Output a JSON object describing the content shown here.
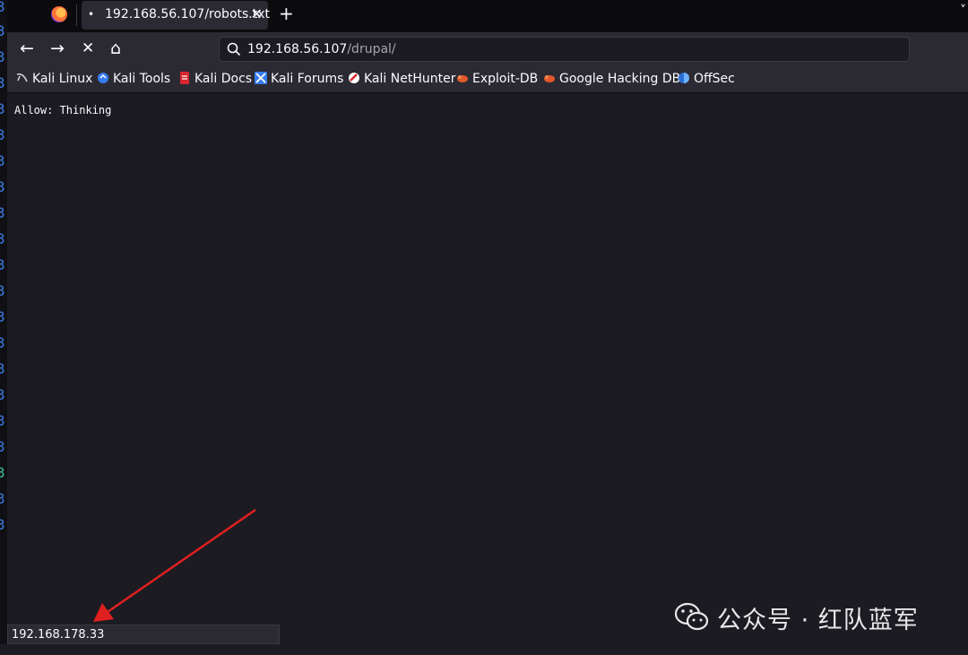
{
  "browser": {
    "tab": {
      "title": "192.168.56.107/robots.txt",
      "dot": "•",
      "close": "✕"
    },
    "new_tab": "+",
    "tab_menu": "˅",
    "nav": {
      "back": "←",
      "forward": "→",
      "stop": "✕",
      "home": "⌂"
    },
    "url": {
      "host": "192.168.56.107",
      "path": "/drupal/"
    }
  },
  "bookmarks": [
    {
      "label": "Kali Linux",
      "icon": "kali-dragon-icon"
    },
    {
      "label": "Kali Tools",
      "icon": "kali-tools-icon"
    },
    {
      "label": "Kali Docs",
      "icon": "kali-docs-icon"
    },
    {
      "label": "Kali Forums",
      "icon": "kali-forums-icon"
    },
    {
      "label": "Kali NetHunter",
      "icon": "nethunter-icon"
    },
    {
      "label": "Exploit-DB",
      "icon": "exploit-db-icon"
    },
    {
      "label": "Google Hacking DB",
      "icon": "ghdb-icon"
    },
    {
      "label": "OffSec",
      "icon": "offsec-icon"
    }
  ],
  "content": {
    "text": "Allow: Thinking"
  },
  "status": {
    "text": "192.168.178.33"
  },
  "watermark": {
    "text": "公众号 · 红队蓝军",
    "icon": "wechat-icon"
  },
  "colors": {
    "accent_arrow": "#e02020",
    "page_bg": "#1c1b22",
    "toolbar_bg": "#2b2a33"
  }
}
